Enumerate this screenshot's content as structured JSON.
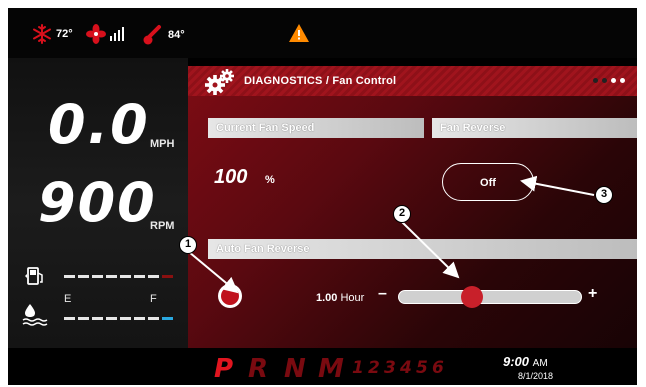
{
  "status": {
    "ambient_temp": "72°",
    "engine_temp": "84°",
    "warning_icon": "warning-triangle-icon"
  },
  "gauges": {
    "speed_value": "0.0",
    "speed_unit": "MPH",
    "rpm_value": "900",
    "rpm_unit": "RPM",
    "fuel_empty_label": "E",
    "fuel_full_label": "F"
  },
  "header": {
    "title": "DIAGNOSTICS / Fan Control"
  },
  "fan_speed": {
    "label": "Current Fan Speed",
    "value": "100",
    "unit": "%"
  },
  "fan_reverse": {
    "label": "Fan Reverse",
    "button_label": "Off"
  },
  "auto_fan_reverse": {
    "label": "Auto Fan Reverse",
    "interval_value": "1.00",
    "interval_unit": "Hour",
    "minus_label": "–",
    "plus_label": "+",
    "slider_level_fraction": 0.4
  },
  "gears": {
    "p": "P",
    "r": "R",
    "n": "N",
    "m": "M",
    "g1": "1",
    "g2": "2",
    "g3": "3",
    "g4": "4",
    "g5": "5",
    "g6": "6"
  },
  "clock": {
    "time": "9:00",
    "ampm": "AM",
    "date": "8/1/2018"
  },
  "callouts": {
    "c1": "1",
    "c2": "2",
    "c3": "3"
  },
  "colors": {
    "accent_red": "#a0141d",
    "fuel_bar_end": "#8a1010",
    "def_bar_end": "#2aa8e0"
  }
}
